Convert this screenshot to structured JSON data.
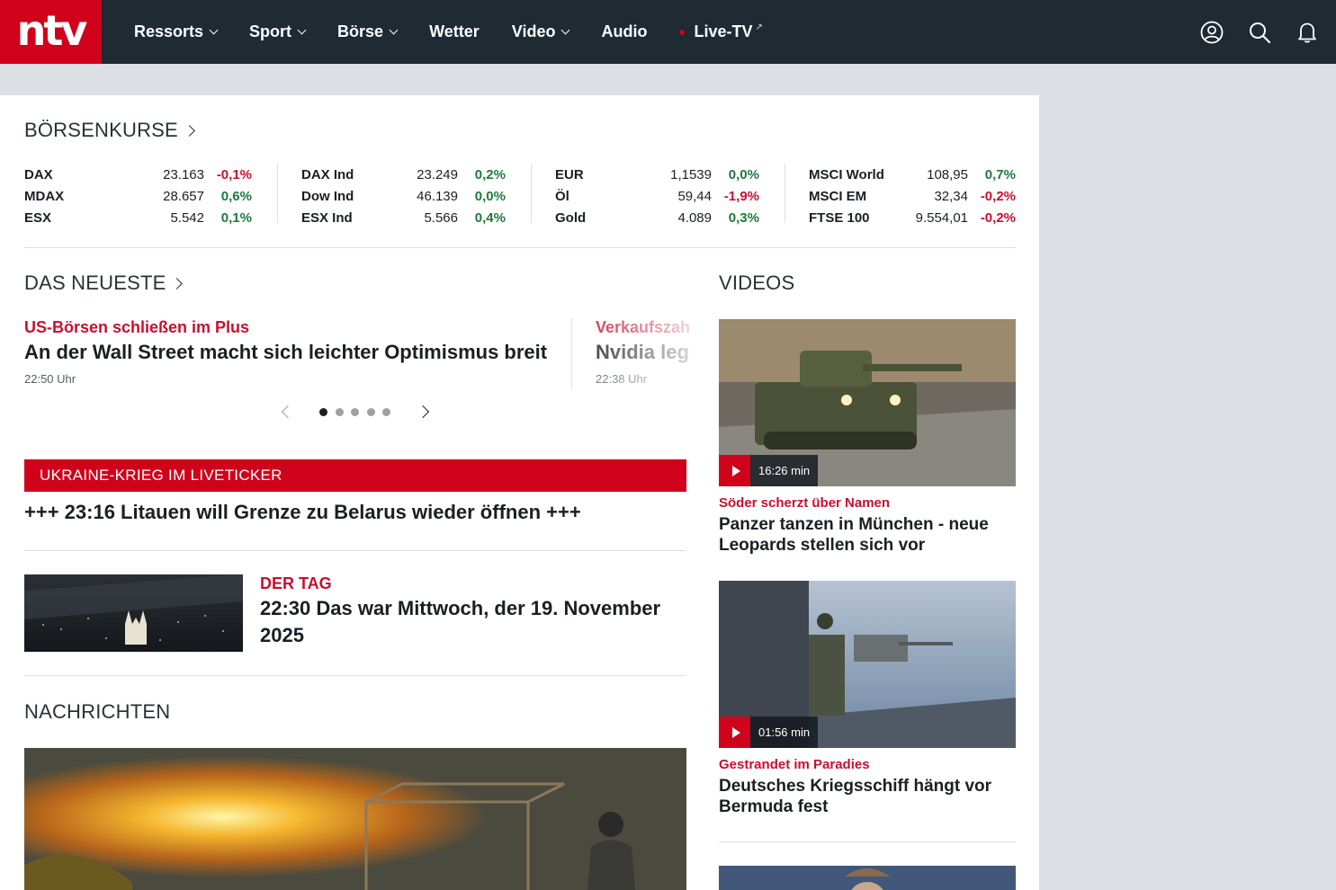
{
  "brand": {
    "logo": "ntv",
    "accent": "#d0021b",
    "header_bg": "#1f2a33"
  },
  "nav": {
    "items": [
      {
        "label": "Ressorts",
        "dropdown": true
      },
      {
        "label": "Sport",
        "dropdown": true
      },
      {
        "label": "Börse",
        "dropdown": true
      },
      {
        "label": "Wetter",
        "dropdown": false
      },
      {
        "label": "Video",
        "dropdown": true
      },
      {
        "label": "Audio",
        "dropdown": false
      },
      {
        "label": "Live-TV",
        "dropdown": false,
        "live": true
      }
    ],
    "icons": [
      "account-icon",
      "search-icon",
      "bell-icon"
    ]
  },
  "stocks": {
    "title": "BÖRSENKURSE",
    "columns": [
      [
        {
          "name": "DAX",
          "value": "23.163",
          "change": "-0,1%",
          "dir": "down"
        },
        {
          "name": "MDAX",
          "value": "28.657",
          "change": "0,6%",
          "dir": "up"
        },
        {
          "name": "ESX",
          "value": "5.542",
          "change": "0,1%",
          "dir": "up"
        }
      ],
      [
        {
          "name": "DAX Ind",
          "value": "23.249",
          "change": "0,2%",
          "dir": "up"
        },
        {
          "name": "Dow Ind",
          "value": "46.139",
          "change": "0,0%",
          "dir": "up"
        },
        {
          "name": "ESX Ind",
          "value": "5.566",
          "change": "0,4%",
          "dir": "up"
        }
      ],
      [
        {
          "name": "EUR",
          "value": "1,1539",
          "change": "0,0%",
          "dir": "up"
        },
        {
          "name": "Öl",
          "value": "59,44",
          "change": "-1,9%",
          "dir": "down"
        },
        {
          "name": "Gold",
          "value": "4.089",
          "change": "0,3%",
          "dir": "up"
        }
      ],
      [
        {
          "name": "MSCI World",
          "value": "108,95",
          "change": "0,7%",
          "dir": "up"
        },
        {
          "name": "MSCI EM",
          "value": "32,34",
          "change": "-0,2%",
          "dir": "down"
        },
        {
          "name": "FTSE 100",
          "value": "9.554,01",
          "change": "-0,2%",
          "dir": "down"
        }
      ]
    ]
  },
  "neueste": {
    "title": "DAS NEUESTE",
    "slides": [
      {
        "kicker": "US-Börsen schließen im Plus",
        "headline": "An der Wall Street macht sich leichter Optimismus breit",
        "time": "22:50 Uhr"
      },
      {
        "kicker": "Verkaufszah",
        "headline": "Nvidia leg",
        "time": "22:38 Uhr"
      }
    ],
    "dot_count": 5,
    "active_dot": 0
  },
  "ticker": {
    "label": "UKRAINE-KRIEG IM LIVETICKER",
    "text": "+++ 23:16 Litauen will Grenze zu Belarus wieder öffnen +++"
  },
  "dertag": {
    "kicker": "DER TAG",
    "headline": "22:30 Das war Mittwoch, der 19. November 2025"
  },
  "nachrichten": {
    "title": "NACHRICHTEN"
  },
  "videos": {
    "title": "VIDEOS",
    "items": [
      {
        "duration": "16:26 min",
        "kicker": "Söder scherzt über Namen",
        "headline": "Panzer tanzen in München - neue Leopards stellen sich vor"
      },
      {
        "duration": "01:56 min",
        "kicker": "Gestrandet im Paradies",
        "headline": "Deutsches Kriegsschiff hängt vor Bermuda fest"
      }
    ]
  }
}
